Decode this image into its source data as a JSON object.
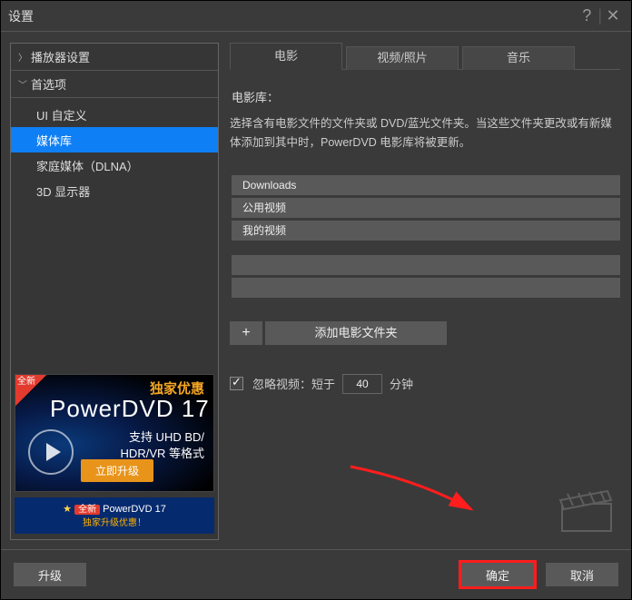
{
  "window": {
    "title": "设置"
  },
  "sidebar": {
    "parent": "播放器设置",
    "section": "首选项",
    "items": [
      "UI 自定义",
      "媒体库",
      "家庭媒体（DLNA）",
      "3D 显示器"
    ],
    "selected": 1
  },
  "promo": {
    "badge": "全新",
    "exclusive": "独家优惠",
    "product": "PowerDVD 17",
    "line1": "支持 UHD BD/",
    "line2": "HDR/VR 等格式",
    "button": "立即升级"
  },
  "promo2": {
    "prefix": "全新",
    "title": "PowerDVD 17",
    "sub": "独家升级优惠！"
  },
  "tabs": [
    "电影",
    "视频/照片",
    "音乐"
  ],
  "activeTab": 0,
  "main": {
    "sectionTitle": "电影库：",
    "description": "选择含有电影文件的文件夹或 DVD/蓝光文件夹。当这些文件夹更改或有新媒体添加到其中时，PowerDVD 电影库将被更新。",
    "folders": [
      "Downloads",
      "公用视频",
      "我的视频"
    ],
    "addFolder": "添加电影文件夹",
    "ignore": {
      "label_pre": "忽略视频：短于",
      "value": "40",
      "label_post": "分钟",
      "checked": true
    }
  },
  "footer": {
    "upgrade": "升级",
    "ok": "确定",
    "cancel": "取消"
  }
}
